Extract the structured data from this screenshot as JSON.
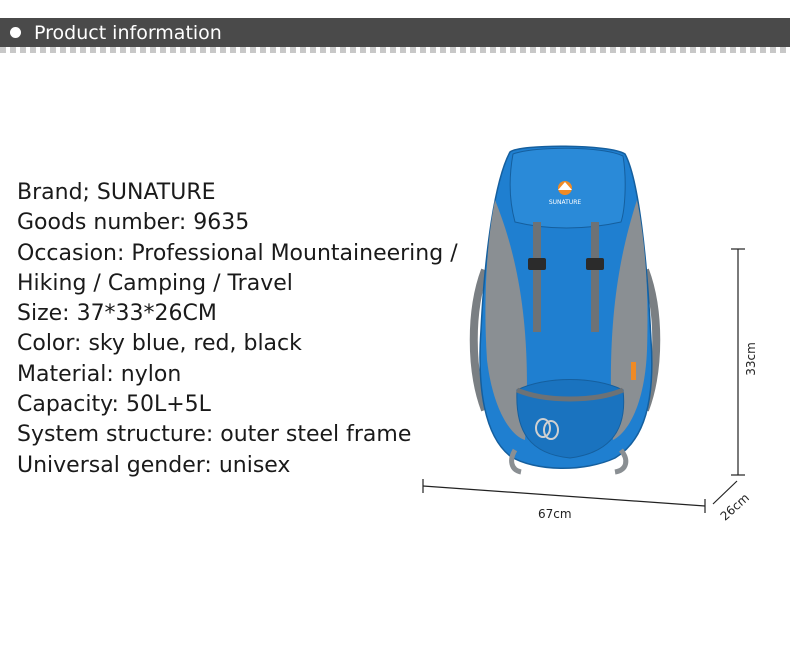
{
  "header": {
    "title": "Product information"
  },
  "specs": [
    "Brand; SUNATURE",
    "Goods number: 9635",
    "Occasion: Professional Mountaineering /",
    "Hiking / Camping / Travel",
    "Size: 37*33*26CM",
    "Color: sky blue, red, black",
    "Material: nylon",
    "Capacity: 50L+5L",
    "System structure: outer steel frame",
    "Universal gender: unisex"
  ],
  "product": {
    "logo_text": "SUNATURE",
    "color": "#1f7fd0",
    "trim_color": "#8a8f93"
  },
  "dimensions": {
    "width_label": "67cm",
    "height_label": "33cm",
    "depth_label": "26cm"
  }
}
